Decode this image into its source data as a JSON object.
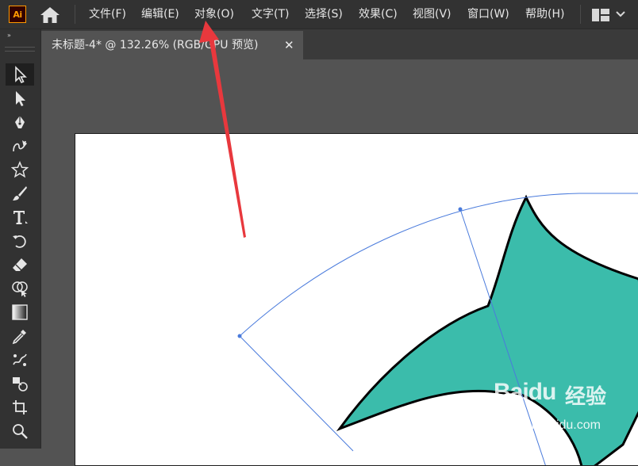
{
  "app": {
    "logo_text": "Ai"
  },
  "menu": {
    "items": [
      "文件(F)",
      "编辑(E)",
      "对象(O)",
      "文字(T)",
      "选择(S)",
      "效果(C)",
      "视图(V)",
      "窗口(W)",
      "帮助(H)"
    ]
  },
  "toolbar": {
    "collapse_mark": "»",
    "tools": [
      "selection-tool",
      "direct-selection-tool",
      "pen-tool",
      "curvature-tool",
      "star-tool",
      "paintbrush-tool",
      "type-tool",
      "rotate-tool",
      "eraser-tool",
      "shape-builder-tool",
      "gradient-tool",
      "eyedropper-tool",
      "puppet-warp-tool",
      "blend-tool",
      "crop-tool",
      "zoom-tool"
    ],
    "active_tool": "selection-tool"
  },
  "document": {
    "tab_title": "未标题-4* @ 132.26% (RGB/GPU 预览)",
    "close_glyph": "✕"
  },
  "artwork": {
    "shape_fill": "#3bbcab",
    "shape_stroke": "#000000",
    "guide_color": "#4a7bdc"
  },
  "annotation": {
    "arrow_color": "#e8383d"
  },
  "watermark": {
    "brand": "Baidu",
    "brand_cn": "经验",
    "url": "jingyan.baidu.com"
  }
}
